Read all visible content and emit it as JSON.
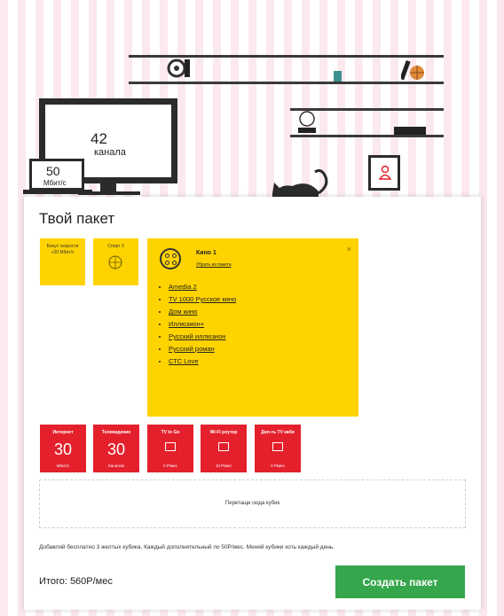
{
  "scene": {
    "tv_channels_number": "42",
    "tv_channels_label": "канала",
    "laptop_speed_number": "50",
    "laptop_speed_label": "Мбит/с"
  },
  "package": {
    "title": "Твой пакет",
    "yellow_small": [
      {
        "label": "Бонус скорости +20 Мбит/с"
      },
      {
        "label": "Спорт 3"
      }
    ],
    "expanded": {
      "title": "Кино 1",
      "subtitle": "Убрать из пакета",
      "close": "×",
      "channels": [
        "Amedia 2",
        "TV 1000 Русское кино",
        "Дом кино",
        "Иллюзион+",
        "Русский иллюзион",
        "Русский роман",
        "СТС Love"
      ]
    },
    "red_cubes": [
      {
        "title": "Интернет",
        "value": "30",
        "unit": "Мбит/с",
        "icon": ""
      },
      {
        "title": "Телевидение",
        "value": "30",
        "unit": "Каналов",
        "icon": ""
      },
      {
        "title": "TV to Go",
        "value": "",
        "unit": "0 Р/мес",
        "icon": "screens-icon"
      },
      {
        "title": "Wi-Fi роутер",
        "value": "",
        "unit": "10 Р/мес",
        "icon": "router-icon"
      },
      {
        "title": "Доп-ть TV каби",
        "value": "",
        "unit": "0 Р/мес",
        "icon": "tv-box-icon"
      }
    ],
    "dropzone_text": "Перетащи сюда кубик",
    "note": "Добавляй бесплатно 3 желтых кубика. Каждый дополнительный по 50Р/мес. Меняй кубики хоть каждый день.",
    "total": "Итого: 560Р/мес",
    "create_button": "Создать пакет"
  },
  "colors": {
    "yellow": "#ffd300",
    "red": "#e4202c",
    "green": "#35a64b"
  }
}
